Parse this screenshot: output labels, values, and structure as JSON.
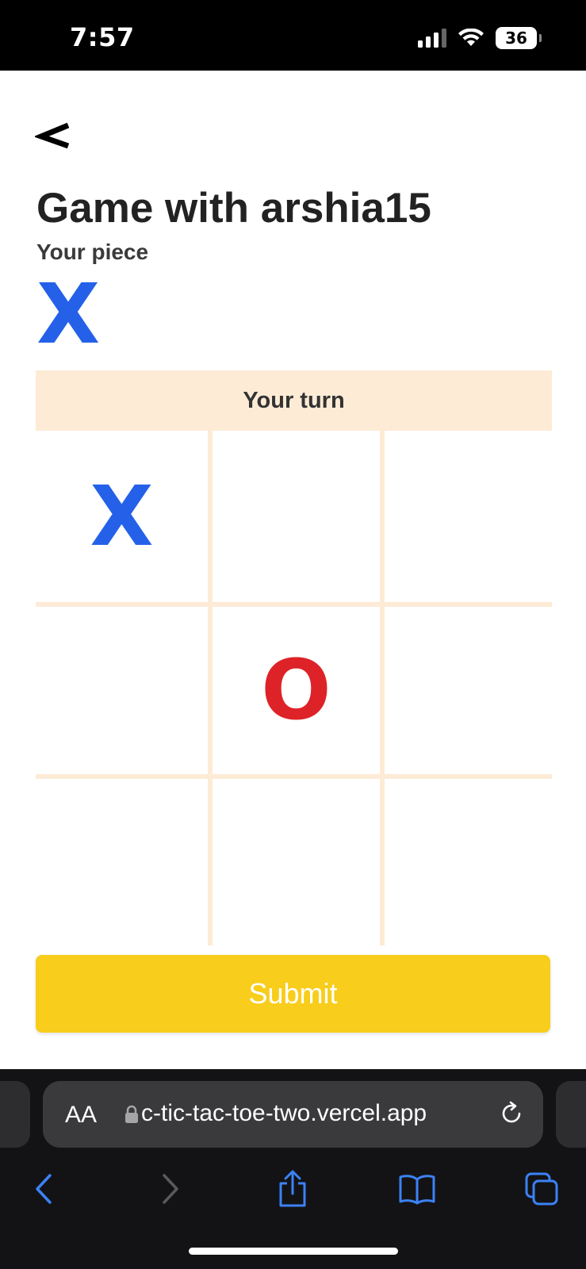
{
  "status_bar": {
    "time": "7:57",
    "battery": "36"
  },
  "header": {
    "back_label": "<",
    "title": "Game with arshia15",
    "piece_label": "Your piece",
    "piece": "X"
  },
  "game": {
    "turn_status": "Your turn",
    "board": [
      [
        "X",
        "",
        ""
      ],
      [
        "",
        "O",
        ""
      ],
      [
        "",
        "",
        ""
      ]
    ]
  },
  "submit_label": "Submit",
  "browser": {
    "aa_label": "AA",
    "url": "c-tic-tac-toe-two.vercel.app"
  },
  "colors": {
    "x_piece": "#2561e8",
    "o_piece": "#dd2328",
    "accent_yellow": "#f8cd1b",
    "banner_bg": "#fdebd6"
  }
}
